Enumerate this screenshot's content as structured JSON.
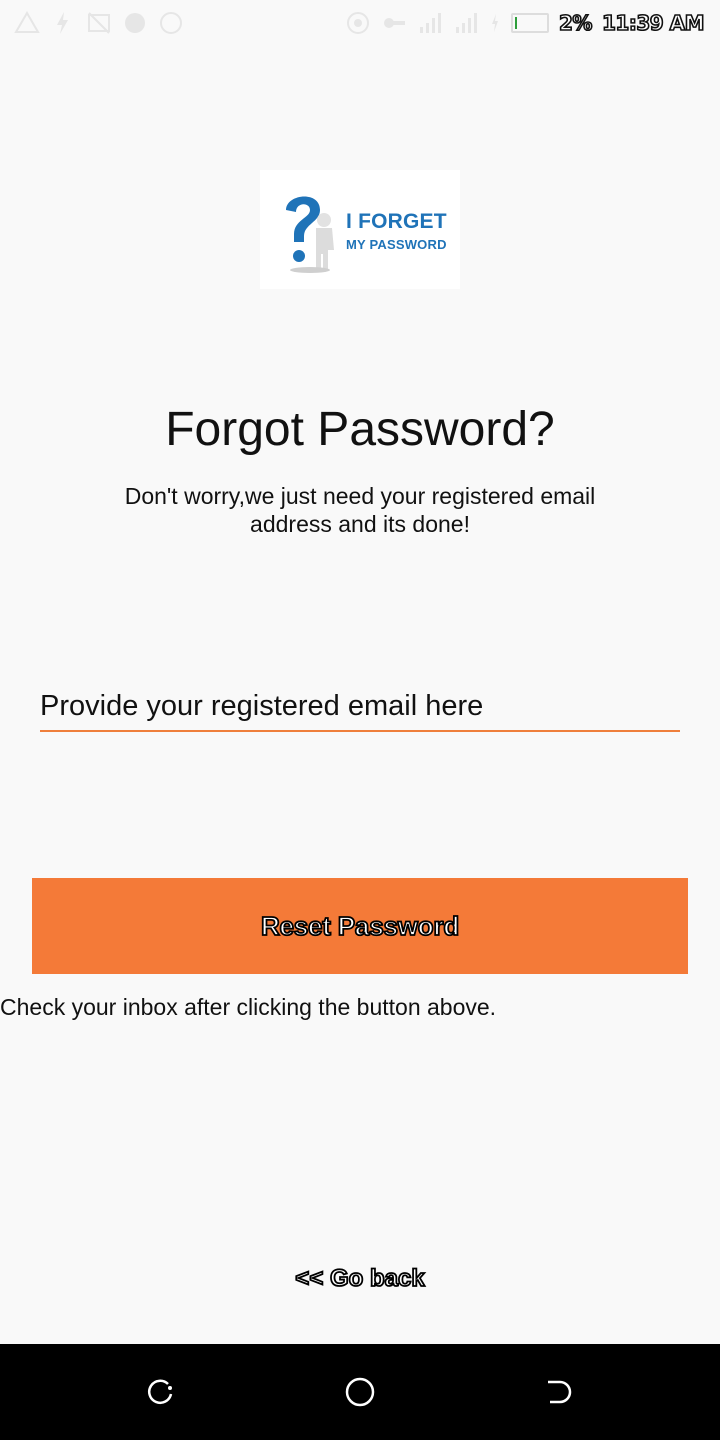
{
  "status_bar": {
    "battery": "2%",
    "time": "11:39 AM",
    "left_icons": [
      "warning-icon",
      "flash-icon",
      "cast-off-icon",
      "globe-icon",
      "circle-icon"
    ],
    "right_icons": [
      "wifi-hotspot-icon",
      "vpn-key-icon",
      "signal-icon",
      "signal-icon",
      "charging-icon",
      "battery-icon"
    ]
  },
  "logo": {
    "line1": "I FORGET",
    "line2": "MY PASSWORD",
    "color": "#1f73b8"
  },
  "header": {
    "title": "Forgot Password?",
    "subtitle": "Don't worry,we just need your registered email address and its done!"
  },
  "form": {
    "email_placeholder": "Provide your registered email here",
    "email_value": ""
  },
  "actions": {
    "reset_label": "Reset Password",
    "accent": "#f47a38"
  },
  "hint": "Check your inbox after clicking the button above.",
  "footer": {
    "go_back": "<< Go back"
  },
  "navigation_bar": {
    "buttons": [
      "recents-icon",
      "home-icon",
      "back-icon"
    ]
  }
}
